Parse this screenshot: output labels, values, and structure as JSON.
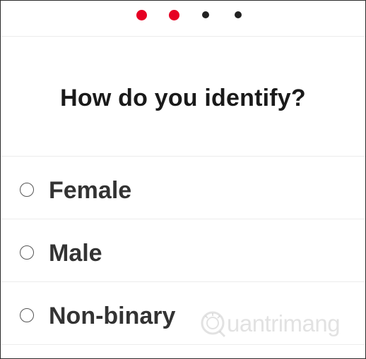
{
  "stepper": {
    "total_steps": 4,
    "completed_steps": 2,
    "active_color": "#e60023",
    "inactive_color": "#222222"
  },
  "question": {
    "title": "How do you identify?"
  },
  "options": [
    {
      "label": "Female",
      "selected": false
    },
    {
      "label": "Male",
      "selected": false
    },
    {
      "label": "Non-binary",
      "selected": false
    }
  ],
  "watermark": {
    "text": "uantrimang",
    "icon": "lightbulb-q-icon"
  }
}
